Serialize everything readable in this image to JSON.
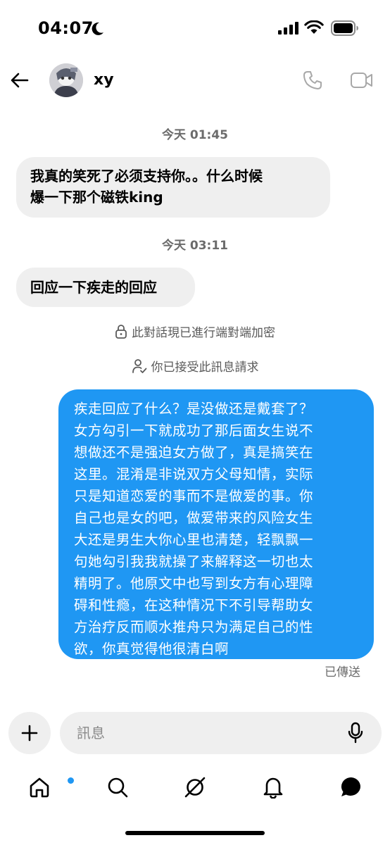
{
  "status_bar": {
    "time": "04:07"
  },
  "header": {
    "contact_name": "xy"
  },
  "messages": [
    {
      "type": "timestamp",
      "text": "今天 01:45"
    },
    {
      "type": "incoming",
      "lines": [
        "我真的笑死了必须支持你。。什么时候",
        "爆一下那个磁铁king"
      ]
    },
    {
      "type": "timestamp",
      "text": "今天 03:11"
    },
    {
      "type": "incoming",
      "lines": [
        "回应一下疾走的回应"
      ]
    },
    {
      "type": "notice",
      "icon": "lock-icon",
      "text": "此對話現已進行端對端加密"
    },
    {
      "type": "notice",
      "icon": "person-check-icon",
      "text": "你已接受此訊息請求"
    },
    {
      "type": "outgoing",
      "lines": [
        "疾走回应了什么？是没做还是戴套了？",
        "女方勾引一下就成功了那后面女生说不",
        "想做还不是强迫女方做了，真是搞笑在",
        "这里。混淆是非说双方父母知情，实际",
        "只是知道恋爱的事而不是做爱的事。你",
        "自己也是女的吧，做爱带来的风险女生",
        "大还是男生大你心里也清楚，轻飘飘一",
        "句她勾引我我就操了来解释这一切也太",
        "精明了。他原文中也写到女方有心理障",
        "碍和性瘾，在这种情况下不引导帮助女",
        "方治疗反而顺水推舟只为满足自己的性",
        "欲，你真觉得他很清白啊"
      ]
    },
    {
      "type": "status",
      "text": "已傳送"
    }
  ],
  "composer": {
    "placeholder": "訊息"
  },
  "colors": {
    "accent": "#1f97f3",
    "bubble_in": "#efefef",
    "text_muted": "#6b6b6b"
  },
  "nav_icons": [
    "home-icon",
    "search-icon",
    "explore-icon",
    "notifications-icon",
    "messages-icon"
  ]
}
